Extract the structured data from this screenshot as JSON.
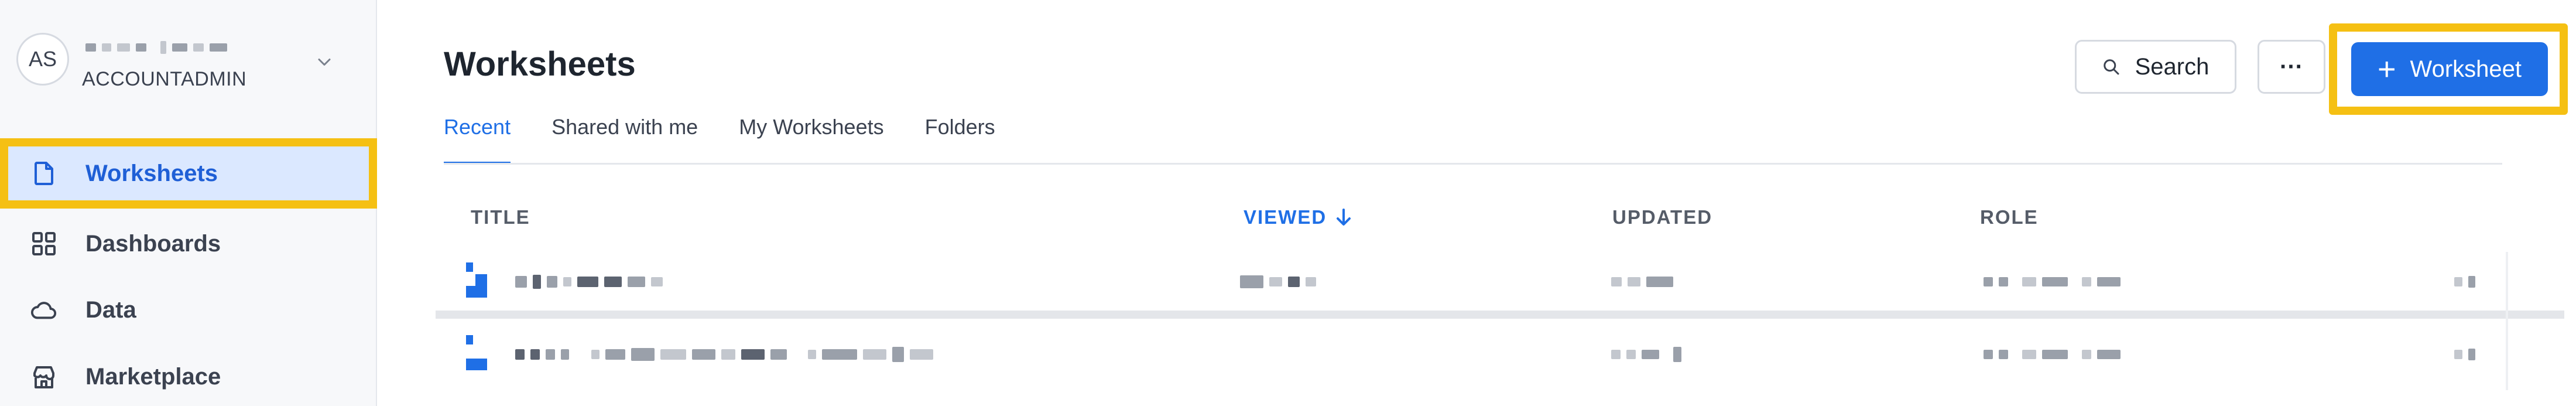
{
  "account": {
    "initials": "AS",
    "role": "ACCOUNTADMIN"
  },
  "sidebar": {
    "items": [
      {
        "label": "Worksheets",
        "icon": "document-icon",
        "active": true
      },
      {
        "label": "Dashboards",
        "icon": "grid-icon",
        "active": false
      },
      {
        "label": "Data",
        "icon": "cloud-icon",
        "active": false
      },
      {
        "label": "Marketplace",
        "icon": "store-icon",
        "active": false
      }
    ]
  },
  "header": {
    "title": "Worksheets",
    "search_label": "Search",
    "more_label": "···",
    "new_worksheet_label": "Worksheet",
    "new_worksheet_plus": "+"
  },
  "tabs": [
    {
      "label": "Recent",
      "active": true
    },
    {
      "label": "Shared with me",
      "active": false
    },
    {
      "label": "My Worksheets",
      "active": false
    },
    {
      "label": "Folders",
      "active": false
    }
  ],
  "table": {
    "columns": [
      "TITLE",
      "VIEWED",
      "UPDATED",
      "ROLE"
    ],
    "sorted_column": "VIEWED",
    "sort_direction": "descending"
  },
  "colors": {
    "accent": "#1f6fe6",
    "highlight": "#f5c013",
    "active_nav_bg": "#dbe8ff"
  }
}
